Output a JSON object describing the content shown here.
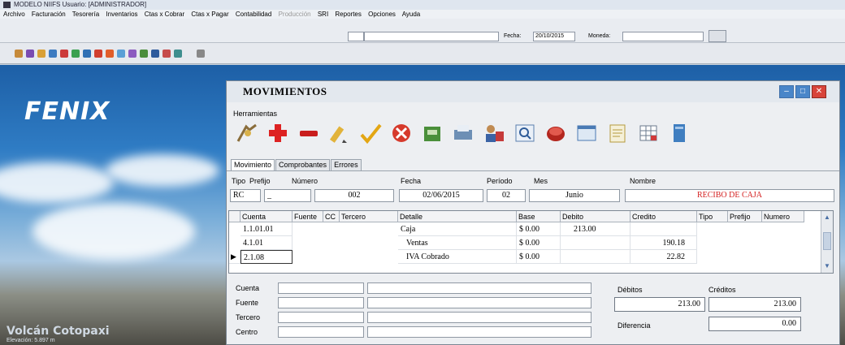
{
  "app": {
    "title": "MODELO NIIFS   Usuario: [ADMINISTRADOR]"
  },
  "menu": [
    "Archivo",
    "Facturación",
    "Tesorería",
    "Inventarios",
    "Ctas x Cobrar",
    "Ctas x Pagar",
    "Contabilidad",
    "Producción",
    "SRI",
    "Reportes",
    "Opciones",
    "Ayuda"
  ],
  "menu_disabled": [
    "Producción"
  ],
  "top_toolbar": {
    "fecha_label": "Fecha:",
    "fecha_value": "20/10/2015",
    "moneda_label": "Moneda:"
  },
  "desktop": {
    "logo_text": "FENIX",
    "wallpaper_title": "Volcán Cotopaxi",
    "wallpaper_subtitle": "Elevación: 5.897 m"
  },
  "window": {
    "title": "MOVIMIENTOS",
    "menu_label": "Herramientas",
    "icons": [
      "new-icon",
      "add-icon",
      "remove-icon",
      "edit-icon",
      "check-icon",
      "cancel-icon",
      "export-icon",
      "print-icon",
      "users-icon",
      "search-icon",
      "record-icon",
      "window-icon",
      "document-icon",
      "grid-icon",
      "file-icon"
    ],
    "tabs": [
      "Movimiento",
      "Comprobantes",
      "Errores"
    ],
    "header": {
      "labels": {
        "tipo": "Tipo",
        "prefijo": "Prefijo",
        "numero": "Número",
        "fecha": "Fecha",
        "periodo": "Período",
        "mes": "Mes",
        "nombre": "Nombre"
      },
      "values": {
        "tipo": "RC",
        "prefijo": "_",
        "numero": "002",
        "fecha": "02/06/2015",
        "periodo": "02",
        "mes": "Junio",
        "nombre": "RECIBO DE CAJA"
      }
    },
    "grid": {
      "columns": [
        "Cuenta",
        "Fuente",
        "CC",
        "Tercero",
        "Detalle",
        "Base",
        "Debito",
        "Credito",
        "Tipo",
        "Prefijo",
        "Numero"
      ],
      "rows": [
        {
          "cuenta": "1.1.01.01",
          "detalle": "Caja",
          "base": "$ 0.00",
          "debito": "213.00",
          "credito": ""
        },
        {
          "cuenta": "4.1.01",
          "detalle": "Ventas",
          "base": "$ 0.00",
          "debito": "",
          "credito": "190.18"
        },
        {
          "cuenta": "2.1.08",
          "detalle": "IVA Cobrado",
          "base": "$ 0.00",
          "debito": "",
          "credito": "22.82"
        }
      ]
    },
    "bottom": {
      "labels": [
        "Cuenta",
        "Fuente",
        "Tercero",
        "Centro"
      ],
      "debitos_label": "Débitos",
      "creditos_label": "Créditos",
      "debitos_value": "213.00",
      "creditos_value": "213.00",
      "diferencia_label": "Diferencia",
      "diferencia_value": "0.00"
    }
  },
  "colors": {
    "nombre_text": "#d42020",
    "close_button": "#d8443a",
    "window_buttons": "#4a86c9"
  }
}
